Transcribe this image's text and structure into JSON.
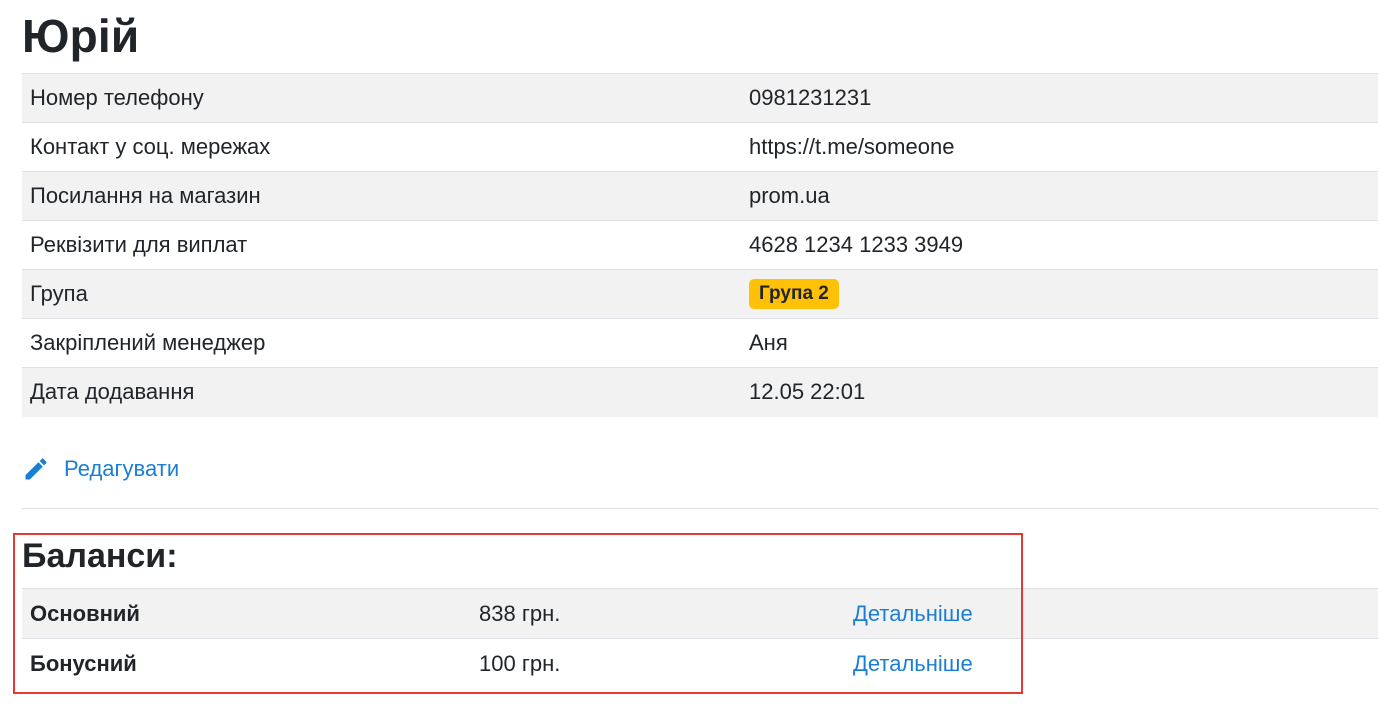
{
  "profile": {
    "name": "Юрій",
    "rows": [
      {
        "label": "Номер телефону",
        "value": "0981231231"
      },
      {
        "label": "Контакт у соц. мережах",
        "value": "https://t.me/someone"
      },
      {
        "label": "Посилання на магазин",
        "value": "prom.ua"
      },
      {
        "label": "Реквізити для виплат",
        "value": "4628 1234 1233 3949"
      },
      {
        "label": "Група",
        "value": "Група 2"
      },
      {
        "label": "Закріплений менеджер",
        "value": "Аня"
      },
      {
        "label": "Дата додавання",
        "value": "12.05 22:01"
      }
    ],
    "edit_label": "Редагувати"
  },
  "balances": {
    "title": "Баланси:",
    "rows": [
      {
        "name": "Основний",
        "amount": "838 грн.",
        "link": "Детальніше"
      },
      {
        "name": "Бонусний",
        "amount": "100 грн.",
        "link": "Детальніше"
      }
    ]
  },
  "colors": {
    "link": "#1a7fd4",
    "badge": "#ffc107",
    "highlight": "#e53935",
    "stripe": "#f2f2f2"
  },
  "icons": {
    "edit": "pencil-icon"
  }
}
